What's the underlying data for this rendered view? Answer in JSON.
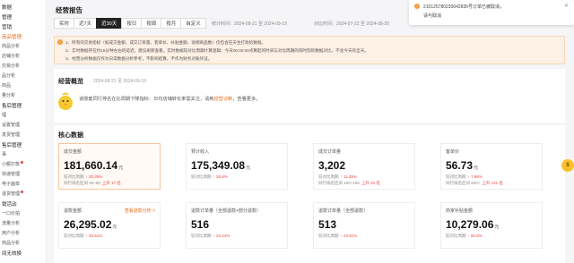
{
  "sidebar": {
    "items": [
      {
        "label": "数据",
        "group": true
      },
      {
        "label": "管理",
        "group": true
      },
      {
        "label": "营销",
        "group": true
      },
      {
        "label": "商品管理",
        "group": true,
        "active": true
      },
      {
        "label": "商品分析"
      },
      {
        "label": "店铺分析"
      },
      {
        "label": "交易分析"
      },
      {
        "label": "品分析"
      },
      {
        "label": "商品"
      },
      {
        "label": "量分析"
      },
      {
        "label": "售后管理",
        "group": true
      },
      {
        "label": "理"
      },
      {
        "label": "设置管理"
      },
      {
        "label": "发货管理"
      },
      {
        "label": "售后管理",
        "group": true
      },
      {
        "label": "事"
      },
      {
        "label": "小额打款",
        "dot": true
      },
      {
        "label": "快递管理"
      },
      {
        "label": "电子面单"
      },
      {
        "label": "退货管理",
        "dot": true
      },
      {
        "label": "销活动",
        "group": true
      },
      {
        "label": "一口价拍"
      },
      {
        "label": "流量分析"
      },
      {
        "label": "用户分析"
      },
      {
        "label": "商品分析"
      },
      {
        "label": "间无效换",
        "group": true
      }
    ]
  },
  "header": {
    "title": "经营报告",
    "tabs": [
      "实时",
      "近7天",
      "近30天",
      "按日",
      "按周",
      "按月",
      "自定义"
    ],
    "active_tab": "近30天",
    "stat_range": "统计时间：2024-08-21 至 2024-09-19",
    "compare_range": "对比时间：2024-07-22 至 2024-08-20"
  },
  "notice": {
    "lines": [
      "1、所有的交易指标（如成交金额、成交订单量、客单价、补贴金额、动销商品数）仅包含在天生打款的数据。",
      "2、实时数据存在约15分钟左右的延迟，建议刷新查看。实时数据较对比周期计算逻辑：今天00:00:00点算起的时间与对比周期的同时刻的数据对比，不含今天的全天。",
      "3、经营分析数据仅作为日常数据分析参考，不影响结算，不作为财务对账凭证。"
    ]
  },
  "overview": {
    "title": "经营概览",
    "date": "2024-08-21 至 2024-09-19",
    "message": "该账套同行排名在比周期下降指标：日均店铺转化率需关注，请到",
    "link": "经营诊断",
    "message_end": "，查看更多。"
  },
  "core": {
    "title": "核心数据",
    "cards": [
      {
        "label": "成交金额",
        "value": "181,660.14",
        "unit": "元",
        "r1": "较对比周期",
        "r1v": "↑ 20.35%",
        "r2": "同行排名区间",
        "r2v": "40~60",
        "r2x": "上升 17 名"
      },
      {
        "label": "预计收入",
        "value": "175,349.08",
        "unit": "元",
        "r1": "较对比周期",
        "r1v": "↑ 26.8%",
        "r2": "",
        "r2v": "",
        "r2x": ""
      },
      {
        "label": "成交订单量",
        "value": "3,202",
        "unit": "",
        "r1": "较对比周期",
        "r1v": "↑ 11.45%",
        "r2": "同行排名区间",
        "r2v": "100~150",
        "r2x": "上升 34 名"
      },
      {
        "label": "客单价",
        "value": "56.73",
        "unit": "元",
        "r1": "较对比周期",
        "r1v": "↑ 7.98%",
        "r2": "同行排名区间",
        "r2v": "500+",
        "r2x": "上升 121 名"
      },
      {
        "label": "退款金额",
        "value": "26,295.02",
        "unit": "元",
        "r1": "较对比周期",
        "r1v": "↑ 33.51%",
        "r2": "",
        "r2v": "",
        "r2x": "",
        "extra": "查看退款分析 >"
      },
      {
        "label": "退款订单量（全部退款+部分退款）",
        "value": "516",
        "unit": "",
        "r1": "较对比周期",
        "r1v": "↑ 23.44%",
        "r2": "",
        "r2v": "",
        "r2x": ""
      },
      {
        "label": "退款订单量（全部退款）",
        "value": "513",
        "unit": "",
        "r1": "较对比周期",
        "r1v": "↑ 23.91%",
        "r2": "",
        "r2v": "",
        "r2x": ""
      },
      {
        "label": "商家补贴金额",
        "value": "10,279.06",
        "unit": "元",
        "r1": "较对比周期",
        "r1v": "↑ 50.8%",
        "r2": "",
        "r2v": "",
        "r2x": ""
      }
    ]
  },
  "toast": {
    "message": "210125780230042835号订单已被取消，",
    "message2": "请与取消"
  },
  "float_badge": "$",
  "colors": {
    "accent": "#e96a1c",
    "up": "#e44444",
    "notice_bg": "#fdf0e4"
  }
}
